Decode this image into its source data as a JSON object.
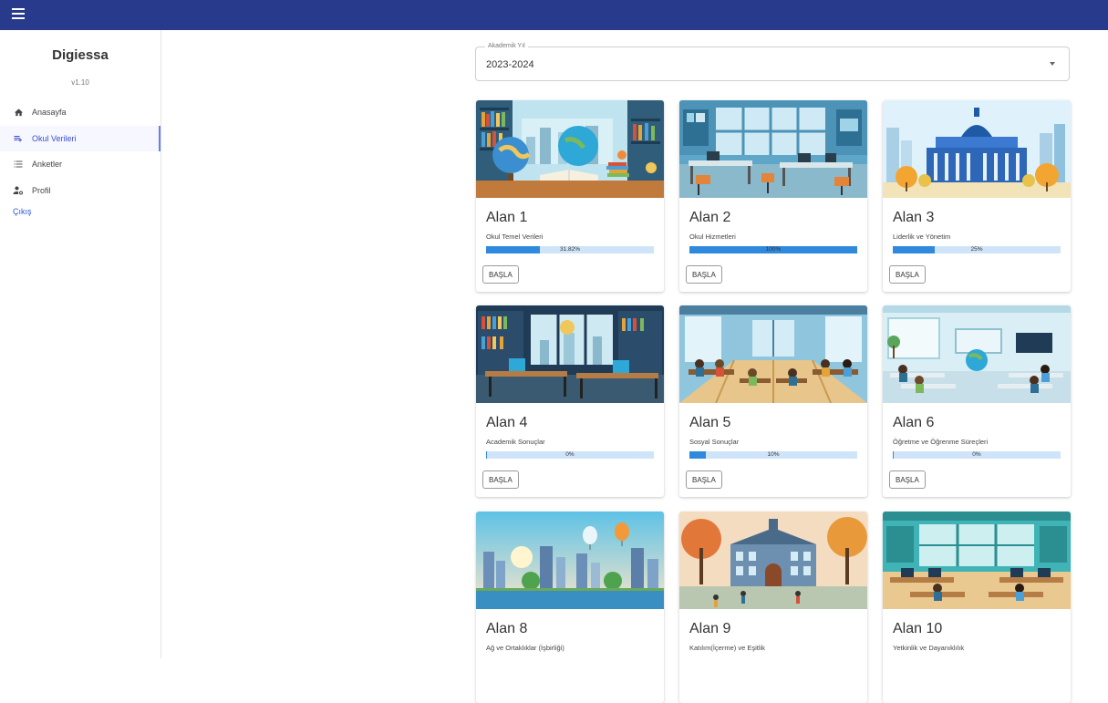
{
  "sidebar": {
    "brand": "Digiessa",
    "version": "v1.10",
    "items": [
      {
        "label": "Anasayfa",
        "icon": "home-icon"
      },
      {
        "label": "Okul Verileri",
        "icon": "playlist-add-icon",
        "active": true
      },
      {
        "label": "Anketler",
        "icon": "list-icon"
      },
      {
        "label": "Profil",
        "icon": "user-settings-icon"
      }
    ],
    "logout": "Çıkış"
  },
  "year_select": {
    "label": "Akademik Yıl",
    "value": "2023-2024"
  },
  "cards": [
    {
      "title": "Alan 1",
      "subtitle": "Okul Temel Verileri",
      "progress": 31.82,
      "progress_text": "31.82%",
      "button": "BAŞLA",
      "image": "library-globe-illustration"
    },
    {
      "title": "Alan 2",
      "subtitle": "Okul Hizmetleri",
      "progress": 100,
      "progress_text": "100%",
      "button": "BAŞLA",
      "image": "office-room-illustration"
    },
    {
      "title": "Alan 3",
      "subtitle": "Liderlik ve Yönetim",
      "progress": 25,
      "progress_text": "25%",
      "button": "BAŞLA",
      "image": "capitol-building-illustration"
    },
    {
      "title": "Alan 4",
      "subtitle": "Academik Sonuçlar",
      "progress": 0,
      "progress_text": "0%",
      "button": "BAŞLA",
      "image": "study-room-illustration"
    },
    {
      "title": "Alan 5",
      "subtitle": "Sosyal Sonuçlar",
      "progress": 10,
      "progress_text": "10%",
      "button": "BAŞLA",
      "image": "busy-classroom-illustration"
    },
    {
      "title": "Alan 6",
      "subtitle": "Öğretme ve Öğrenme Süreçleri",
      "progress": 0,
      "progress_text": "0%",
      "button": "BAŞLA",
      "image": "modern-classroom-illustration"
    },
    {
      "title": "Alan 8",
      "subtitle": "Ağ ve Ortaklıklar (İşbirliği)",
      "image": "city-balloons-illustration"
    },
    {
      "title": "Alan 9",
      "subtitle": "Katılım(İçerme) ve Eşitlik",
      "image": "school-building-illustration"
    },
    {
      "title": "Alan 10",
      "subtitle": "Yetkinlik ve Dayanıklılık",
      "image": "computer-lab-illustration"
    }
  ],
  "colors": {
    "appbar": "#283a8c",
    "accent": "#3b4ed0",
    "progress_fill": "#2f89dc",
    "progress_track": "#cfe4f8"
  }
}
